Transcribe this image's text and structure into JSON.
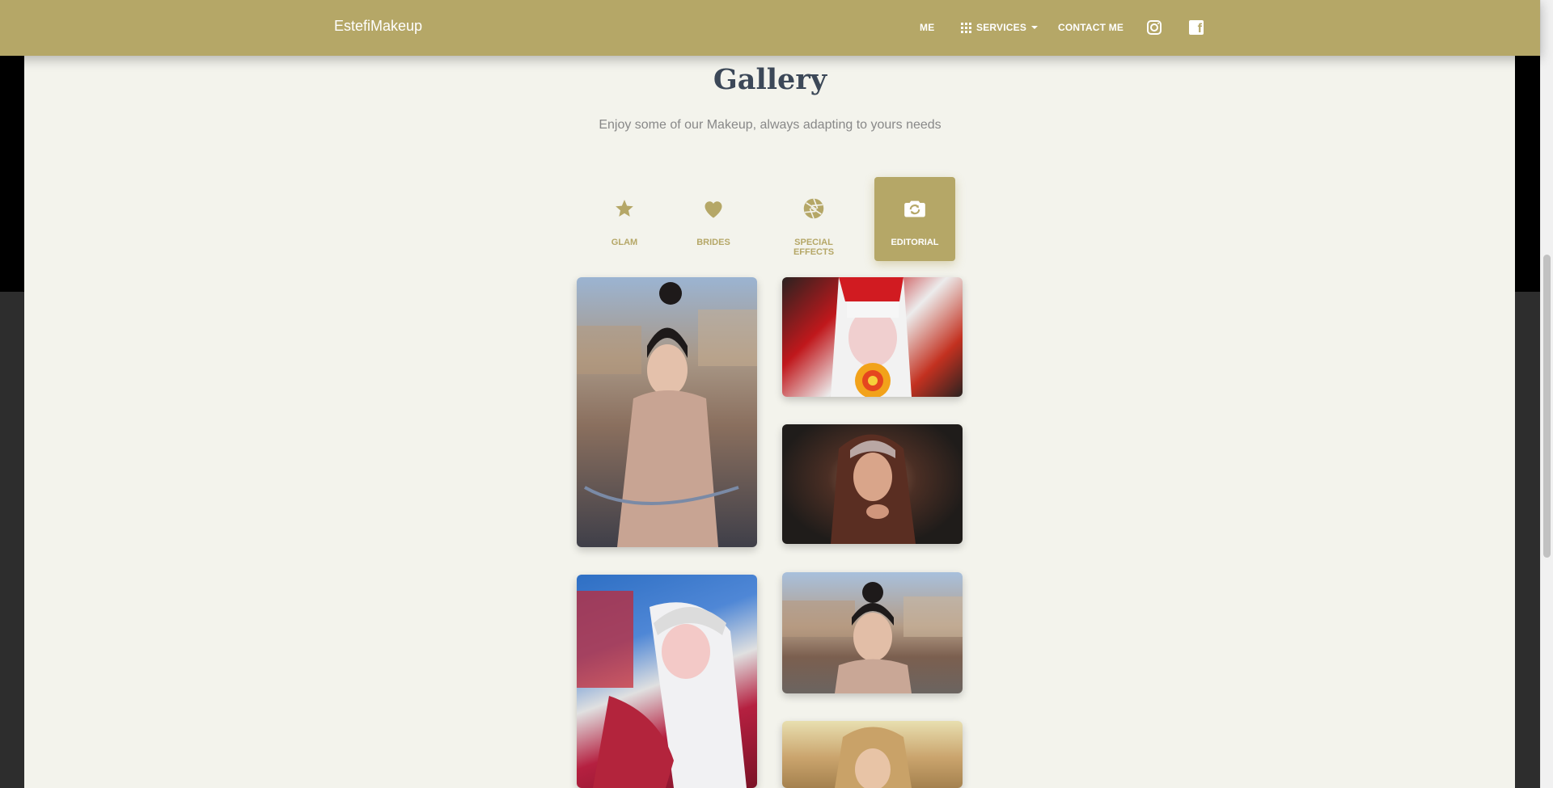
{
  "navbar": {
    "brand": "EstefiMakeup",
    "items": [
      {
        "label": "ME"
      },
      {
        "label": "SERVICES",
        "icon": "grid-icon",
        "dropdown": true
      },
      {
        "label": "CONTACT ME"
      }
    ],
    "social": [
      {
        "icon": "instagram-icon"
      },
      {
        "icon": "facebook-icon"
      }
    ]
  },
  "gallery": {
    "title": "Gallery",
    "subtitle": "Enjoy some of our Makeup, always adapting to yours needs",
    "tabs": [
      {
        "label": "GLAM",
        "icon": "star-icon",
        "active": false
      },
      {
        "label": "BRIDES",
        "icon": "heart-icon",
        "active": false
      },
      {
        "label": "SPECIAL EFFECTS",
        "icon": "aperture-icon",
        "active": false
      },
      {
        "label": "EDITORIAL",
        "icon": "camera-icon",
        "active": true
      }
    ],
    "photos": [
      {
        "subject": "woman-on-bicycle"
      },
      {
        "subject": "red-hat-lollipop"
      },
      {
        "subject": "bandana-portrait"
      },
      {
        "subject": "white-hair-red-coat"
      },
      {
        "subject": "woman-outdoor-portrait"
      },
      {
        "subject": "blonde-portrait"
      }
    ]
  },
  "colors": {
    "accent": "#b5a767",
    "page_bg": "#f3f3ec",
    "title": "#3c4858"
  }
}
